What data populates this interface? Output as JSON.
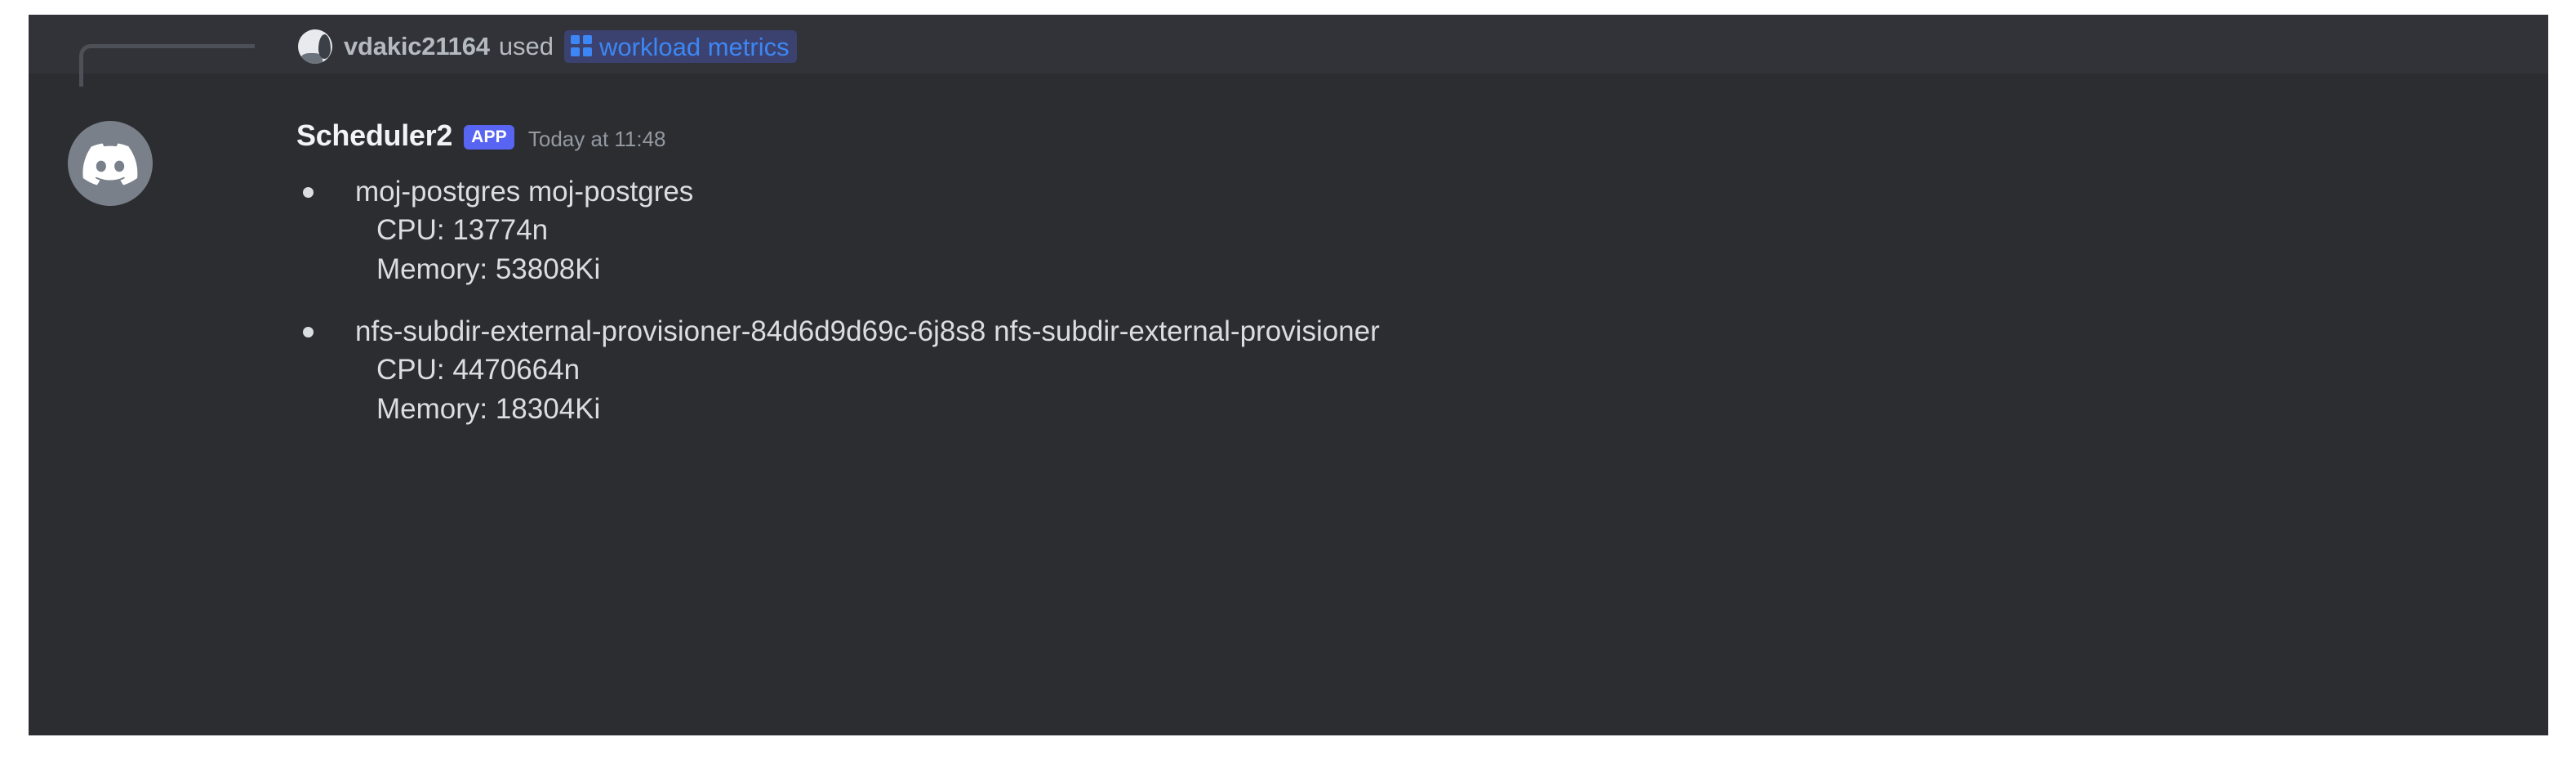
{
  "app": {
    "name": "Discord",
    "theme": "dark",
    "colors": {
      "panel_background": "#2b2d31",
      "reply_strip_background": "#313338",
      "text_primary": "#dbdee1",
      "text_muted": "#b5bac1",
      "timestamp": "#9499a1",
      "command_chip_background": "#3c4270",
      "command_chip_text": "#3c87f5",
      "app_badge_background": "#5865f2",
      "app_badge_text": "#ffffff",
      "reply_spine": "#4e5058",
      "bot_avatar_background": "#7a808a"
    }
  },
  "reply_context": {
    "avatar_name": "user-avatar",
    "username": "vdakic21164",
    "action_text": "used",
    "command": {
      "icon": "apps-grid-icon",
      "label": "workload metrics"
    }
  },
  "message": {
    "author": "Scheduler2",
    "badge": "APP",
    "timestamp": "Today at 11:48",
    "avatar_icon": "discord-clyde-icon",
    "metrics": [
      {
        "title": "moj-postgres moj-postgres",
        "lines": [
          "CPU: 13774n",
          "Memory: 53808Ki"
        ]
      },
      {
        "title": "nfs-subdir-external-provisioner-84d6d9d69c-6j8s8 nfs-subdir-external-provisioner",
        "lines": [
          "CPU: 4470664n",
          "Memory: 18304Ki"
        ]
      }
    ]
  }
}
